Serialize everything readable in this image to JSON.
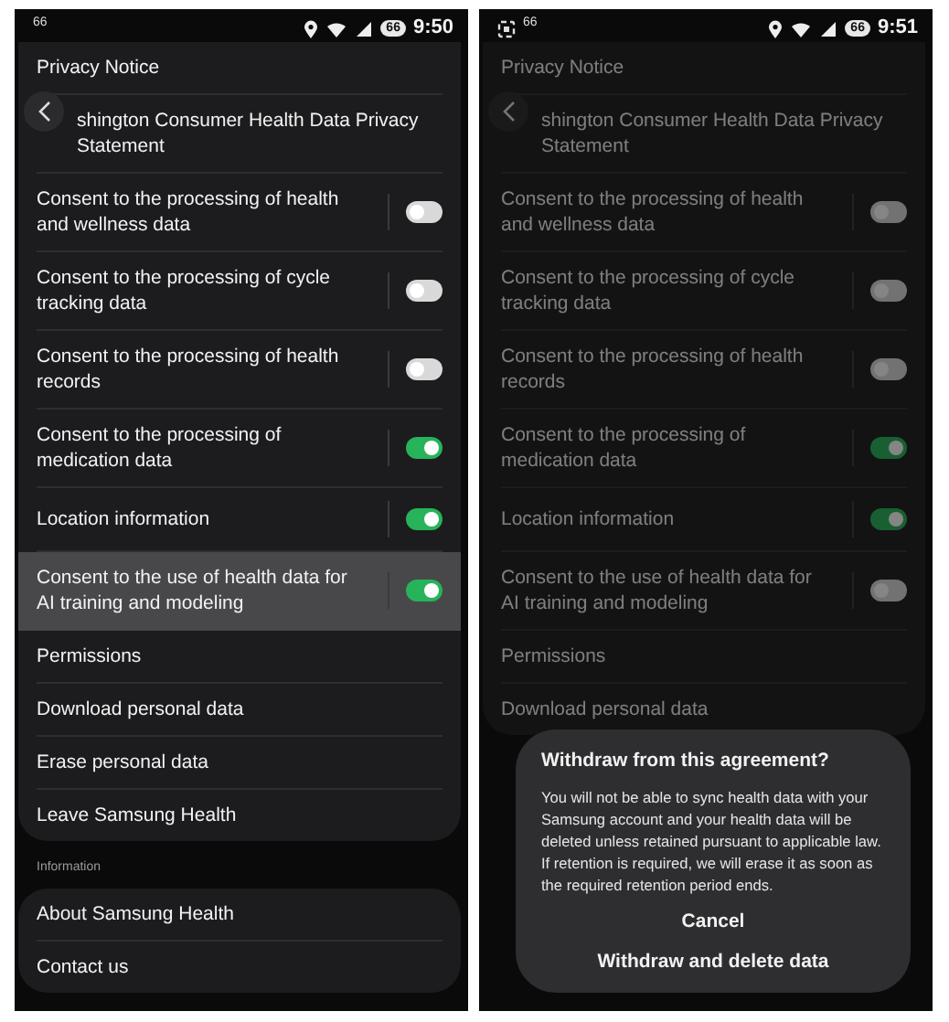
{
  "screens": [
    {
      "status_bar": {
        "screenshot_icon": false,
        "notification_count": "66",
        "battery": "66",
        "time": "9:50"
      },
      "dimmed": false,
      "groups": [
        {
          "items": [
            {
              "kind": "link",
              "label": "Privacy Notice",
              "highlighted": false
            },
            {
              "kind": "link",
              "label": "shington Consumer Health Data Privacy Statement",
              "highlighted": false
            },
            {
              "kind": "toggle",
              "label": "Consent to the processing of health and wellness data",
              "on": false,
              "highlighted": false
            },
            {
              "kind": "toggle",
              "label": "Consent to the processing of cycle tracking data",
              "on": false,
              "highlighted": false
            },
            {
              "kind": "toggle",
              "label": "Consent to the processing of health records",
              "on": false,
              "highlighted": false
            },
            {
              "kind": "toggle",
              "label": "Consent to the processing of medication data",
              "on": true,
              "highlighted": false
            },
            {
              "kind": "toggle",
              "label": "Location information",
              "on": true,
              "highlighted": false
            },
            {
              "kind": "toggle",
              "label": "Consent to the use of health data for AI training and modeling",
              "on": true,
              "highlighted": true
            },
            {
              "kind": "link",
              "label": "Permissions",
              "highlighted": false
            },
            {
              "kind": "link",
              "label": "Download personal data",
              "highlighted": false
            },
            {
              "kind": "link",
              "label": "Erase personal data",
              "highlighted": false
            },
            {
              "kind": "link",
              "label": "Leave Samsung Health",
              "highlighted": false
            }
          ]
        },
        {
          "heading": "Information",
          "items": [
            {
              "kind": "link",
              "label": "About Samsung Health",
              "highlighted": false
            },
            {
              "kind": "link",
              "label": "Contact us",
              "highlighted": false
            }
          ]
        }
      ]
    },
    {
      "status_bar": {
        "screenshot_icon": true,
        "notification_count": "66",
        "battery": "66",
        "time": "9:51"
      },
      "dimmed": true,
      "groups": [
        {
          "items": [
            {
              "kind": "link",
              "label": "Privacy Notice",
              "highlighted": false
            },
            {
              "kind": "link",
              "label": "shington Consumer Health Data Privacy Statement",
              "highlighted": false
            },
            {
              "kind": "toggle",
              "label": "Consent to the processing of health and wellness data",
              "on": false,
              "highlighted": false
            },
            {
              "kind": "toggle",
              "label": "Consent to the processing of cycle tracking data",
              "on": false,
              "highlighted": false
            },
            {
              "kind": "toggle",
              "label": "Consent to the processing of health records",
              "on": false,
              "highlighted": false
            },
            {
              "kind": "toggle",
              "label": "Consent to the processing of medication data",
              "on": true,
              "highlighted": false
            },
            {
              "kind": "toggle",
              "label": "Location information",
              "on": true,
              "highlighted": false
            },
            {
              "kind": "toggle",
              "label": "Consent to the use of health data for AI training and modeling",
              "on": false,
              "highlighted": false
            },
            {
              "kind": "link",
              "label": "Permissions",
              "highlighted": false
            },
            {
              "kind": "link",
              "label": "Download personal data",
              "highlighted": false
            }
          ]
        }
      ],
      "dialog": {
        "title": "Withdraw from this agreement?",
        "message": "You will not be able to sync health data with your Samsung account and your health data will be deleted unless retained pursuant to applicable law. If retention is required, we will erase it as soon as the required retention period ends.",
        "buttons": [
          "Cancel",
          "Withdraw and delete data"
        ]
      }
    }
  ]
}
